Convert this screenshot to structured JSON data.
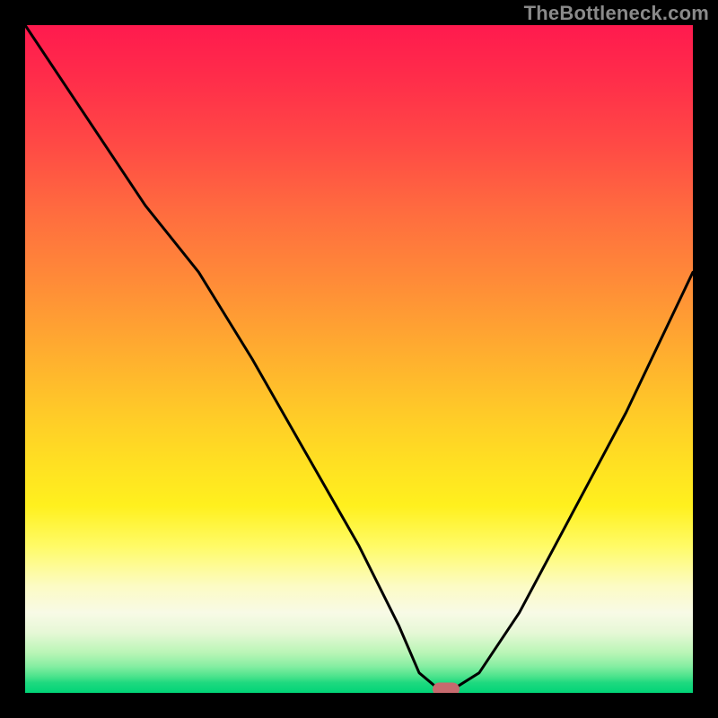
{
  "watermark": "TheBottleneck.com",
  "colors": {
    "frame": "#000000",
    "curve": "#000000",
    "marker": "#c76a6e"
  },
  "chart_data": {
    "type": "line",
    "title": "",
    "xlabel": "",
    "ylabel": "",
    "xlim": [
      0,
      100
    ],
    "ylim": [
      0,
      100
    ],
    "grid": false,
    "legend": false,
    "series": [
      {
        "name": "bottleneck-curve",
        "x": [
          0,
          8,
          18,
          26,
          34,
          42,
          50,
          56,
          59,
          62,
          64,
          68,
          74,
          82,
          90,
          100
        ],
        "values": [
          100,
          88,
          73,
          63,
          50,
          36,
          22,
          10,
          3,
          0.5,
          0.5,
          3,
          12,
          27,
          42,
          63
        ]
      }
    ],
    "annotations": [
      {
        "name": "optimal-marker",
        "x": 63,
        "y": 0.5
      }
    ],
    "background_gradient": {
      "direction": "vertical",
      "stops": [
        {
          "pos": 0.0,
          "color": "#ff1a4e"
        },
        {
          "pos": 0.5,
          "color": "#ffca28"
        },
        {
          "pos": 0.8,
          "color": "#fffb66"
        },
        {
          "pos": 0.92,
          "color": "#e6f8d6"
        },
        {
          "pos": 1.0,
          "color": "#00d477"
        }
      ]
    }
  }
}
